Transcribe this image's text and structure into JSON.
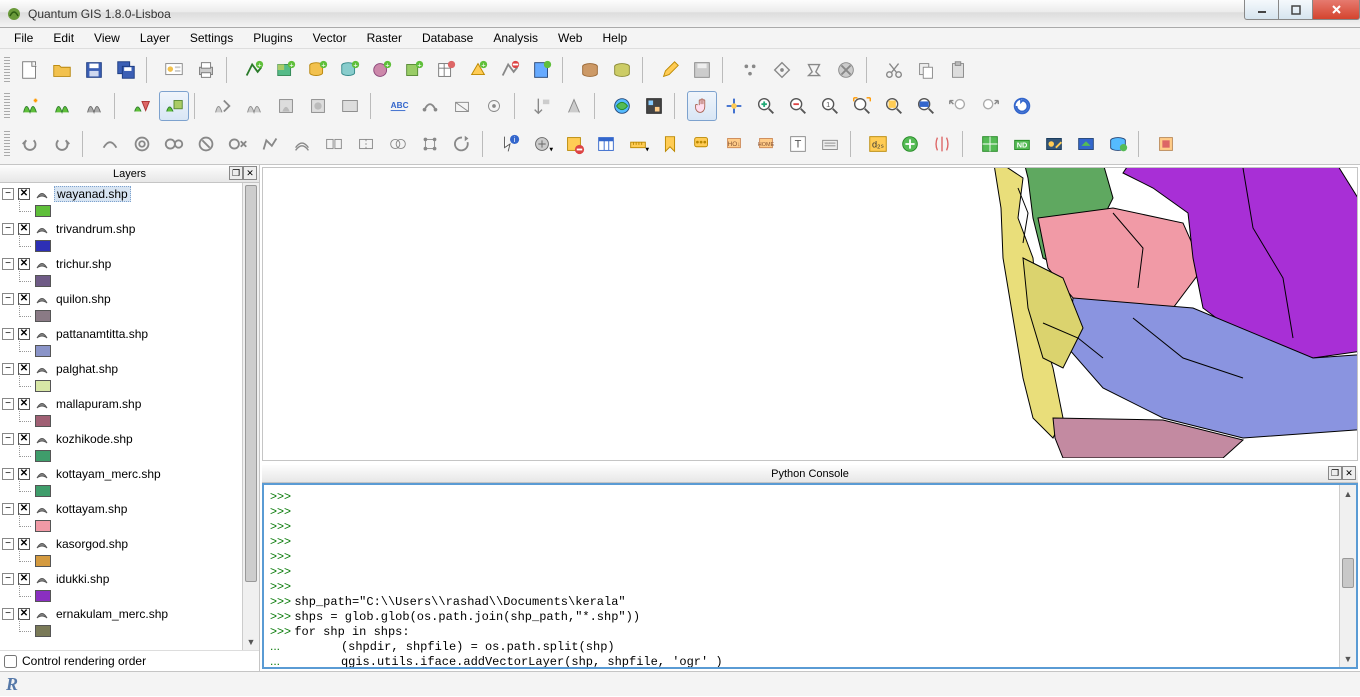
{
  "window": {
    "title": "Quantum GIS 1.8.0-Lisboa"
  },
  "menu": [
    "File",
    "Edit",
    "View",
    "Layer",
    "Settings",
    "Plugins",
    "Vector",
    "Raster",
    "Database",
    "Analysis",
    "Web",
    "Help"
  ],
  "panels": {
    "layers_title": "Layers",
    "python_title": "Python Console",
    "control_render": "Control rendering order"
  },
  "layers": [
    {
      "name": "wayanad.shp",
      "color": "#5fbf3a",
      "selected": true
    },
    {
      "name": "trivandrum.shp",
      "color": "#2d2fb5"
    },
    {
      "name": "trichur.shp",
      "color": "#6f5b86"
    },
    {
      "name": "quilon.shp",
      "color": "#8a7a85"
    },
    {
      "name": "pattanamtitta.shp",
      "color": "#8a94c8"
    },
    {
      "name": "palghat.shp",
      "color": "#d8e7a6"
    },
    {
      "name": "mallapuram.shp",
      "color": "#a06074"
    },
    {
      "name": "kozhikode.shp",
      "color": "#3f9d6b"
    },
    {
      "name": "kottayam_merc.shp",
      "color": "#3f9d6b"
    },
    {
      "name": "kottayam.shp",
      "color": "#f19aa6"
    },
    {
      "name": "kasorgod.shp",
      "color": "#d49a3f"
    },
    {
      "name": "idukki.shp",
      "color": "#8a2fc0"
    },
    {
      "name": "ernakulam_merc.shp",
      "color": "#7a7a58"
    }
  ],
  "python": {
    "lines": [
      {
        "p": ">>> ",
        "t": ""
      },
      {
        "p": ">>> ",
        "t": ""
      },
      {
        "p": ">>> ",
        "t": ""
      },
      {
        "p": ">>> ",
        "t": ""
      },
      {
        "p": ">>> ",
        "t": ""
      },
      {
        "p": ">>> ",
        "t": ""
      },
      {
        "p": ">>> ",
        "t": ""
      },
      {
        "p": ">>> ",
        "t": "shp_path=\"C:\\\\Users\\\\rashad\\\\Documents\\kerala\""
      },
      {
        "p": ">>> ",
        "t": "shps = glob.glob(os.path.join(shp_path,\"*.shp\"))"
      },
      {
        "p": ">>> ",
        "t": "for shp in shps:"
      },
      {
        "p": "... ",
        "t": "        (shpdir, shpfile) = os.path.split(shp)"
      },
      {
        "p": "... ",
        "t": "        qgis.utils.iface.addVectorLayer(shp, shpfile, 'ogr' )"
      },
      {
        "p": "... ",
        "t": ""
      }
    ]
  },
  "icons": {
    "status_r": "R"
  }
}
